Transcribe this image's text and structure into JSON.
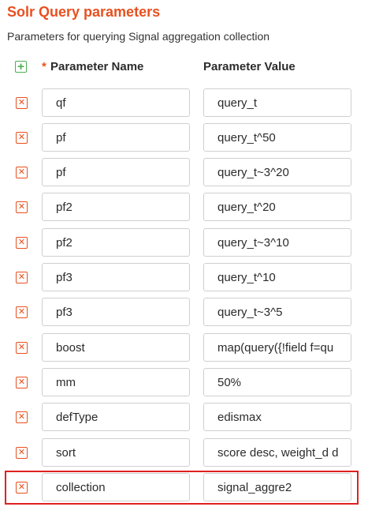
{
  "section": {
    "title": "Solr Query parameters",
    "description": "Parameters for querying Signal aggregation collection"
  },
  "table": {
    "required_mark": "*",
    "name_header": "Parameter Name",
    "value_header": "Parameter Value",
    "add_icon": "plus-icon",
    "delete_icon": "close-icon",
    "rows": [
      {
        "name": "qf",
        "value": "query_t"
      },
      {
        "name": "pf",
        "value": "query_t^50"
      },
      {
        "name": "pf",
        "value": "query_t~3^20"
      },
      {
        "name": "pf2",
        "value": "query_t^20"
      },
      {
        "name": "pf2",
        "value": "query_t~3^10"
      },
      {
        "name": "pf3",
        "value": "query_t^10"
      },
      {
        "name": "pf3",
        "value": "query_t~3^5"
      },
      {
        "name": "boost",
        "value": "map(query({!field f=qu"
      },
      {
        "name": "mm",
        "value": "50%"
      },
      {
        "name": "defType",
        "value": "edismax"
      },
      {
        "name": "sort",
        "value": "score desc, weight_d d"
      },
      {
        "name": "collection",
        "value": "signal_aggre2"
      }
    ]
  },
  "colors": {
    "accent": "#e8501f",
    "add": "#4caf50",
    "highlight": "#e02020"
  }
}
